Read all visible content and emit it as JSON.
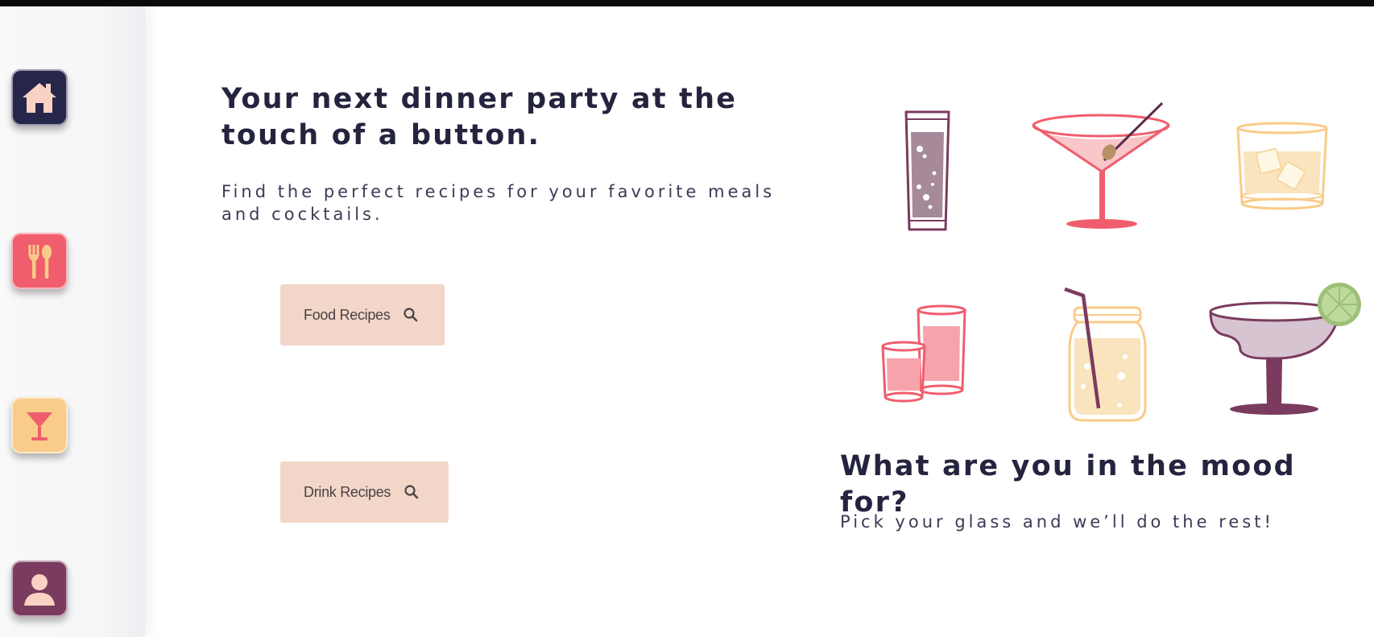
{
  "hero": {
    "title": "Your next dinner party at the touch of a button.",
    "subtitle": "Find the perfect recipes for your favorite meals and cocktails."
  },
  "buttons": {
    "food_label": "Food Recipes",
    "drink_label": "Drink Recipes"
  },
  "mood": {
    "title": "What are you in the mood for?",
    "subtitle": "Pick your glass and we’ll do the rest!"
  },
  "sidebar": {
    "items": [
      {
        "name": "home",
        "icon": "house-icon",
        "color": "#26264a"
      },
      {
        "name": "food",
        "icon": "fork-spoon-icon",
        "color": "#f05d6c"
      },
      {
        "name": "drinks",
        "icon": "cocktail-icon",
        "color": "#f9cc8a"
      },
      {
        "name": "profile",
        "icon": "user-icon",
        "color": "#7a3b5e"
      }
    ]
  },
  "glasses": [
    {
      "name": "highball-glass",
      "icon": "highball-glass-icon"
    },
    {
      "name": "martini-glass",
      "icon": "martini-glass-icon"
    },
    {
      "name": "rocks-glass",
      "icon": "rocks-glass-icon"
    },
    {
      "name": "shot-glasses",
      "icon": "shot-glasses-icon"
    },
    {
      "name": "mason-jar",
      "icon": "mason-jar-icon"
    },
    {
      "name": "margarita-glass",
      "icon": "margarita-glass-icon"
    }
  ],
  "colors": {
    "navy": "#26264a",
    "coral": "#f05d6c",
    "peach": "#f9cc8a",
    "plum": "#7a3b5e",
    "button_bg": "#f2d6c8",
    "text": "#25243f"
  }
}
